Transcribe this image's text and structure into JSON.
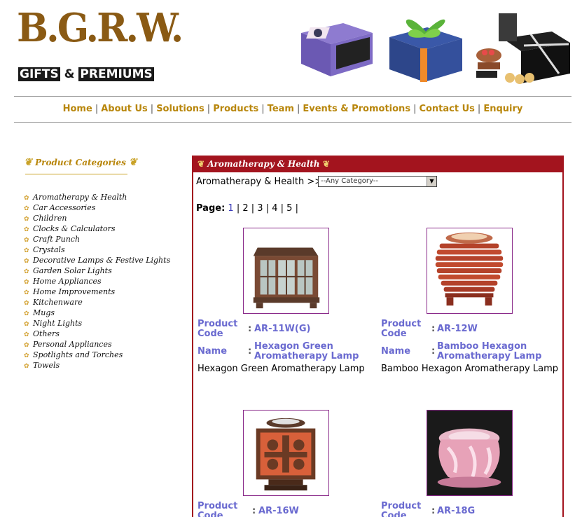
{
  "logo": {
    "big": "B.G.R.W.",
    "small_left": "GIFTS & PREMIUMS"
  },
  "nav": [
    "Home",
    "About Us",
    "Solutions",
    "Products",
    "Team",
    "Events & Promotions",
    "Contact Us",
    "Enquiry"
  ],
  "sidebar": {
    "title": "Product Categories",
    "items": [
      "Aromatherapy & Health",
      "Car Accessories",
      "Children",
      "Clocks & Calculators",
      "Craft Punch",
      "Crystals",
      "Decorative Lamps & Festive Lights",
      "Garden Solar Lights",
      "Home Appliances",
      "Home Improvements",
      "Kitchenware",
      "Mugs",
      "Night Lights",
      "Others",
      "Personal Appliances",
      "Spotlights and Torches",
      "Towels"
    ]
  },
  "panel": {
    "title": "Aromatherapy & Health",
    "filter_label": "Aromatherapy & Health >>",
    "select_value": "--Any Category--",
    "pager_label": "Page:",
    "pages": [
      "1",
      "2",
      "3",
      "4",
      "5"
    ],
    "code_label": "Product Code",
    "code_label_1": "Product",
    "code_label_2": "Code",
    "name_label": "Name",
    "colon": ":",
    "products": [
      {
        "code": "AR-11W(G)",
        "name_1": "Hexagon Green",
        "name_2": "Aromatherapy Lamp",
        "desc": "Hexagon Green Aromatherapy Lamp"
      },
      {
        "code": "AR-12W",
        "name_1": "Bamboo Hexagon",
        "name_2": "Aromatherapy Lamp",
        "desc": "Bamboo Hexagon Aromatherapy Lamp"
      },
      {
        "code": "AR-16W"
      },
      {
        "code": "AR-18G"
      }
    ]
  },
  "colors": {
    "brand_gold": "#b8860b",
    "panel_red": "#a3141e",
    "link_blue": "#6a6ad0"
  }
}
